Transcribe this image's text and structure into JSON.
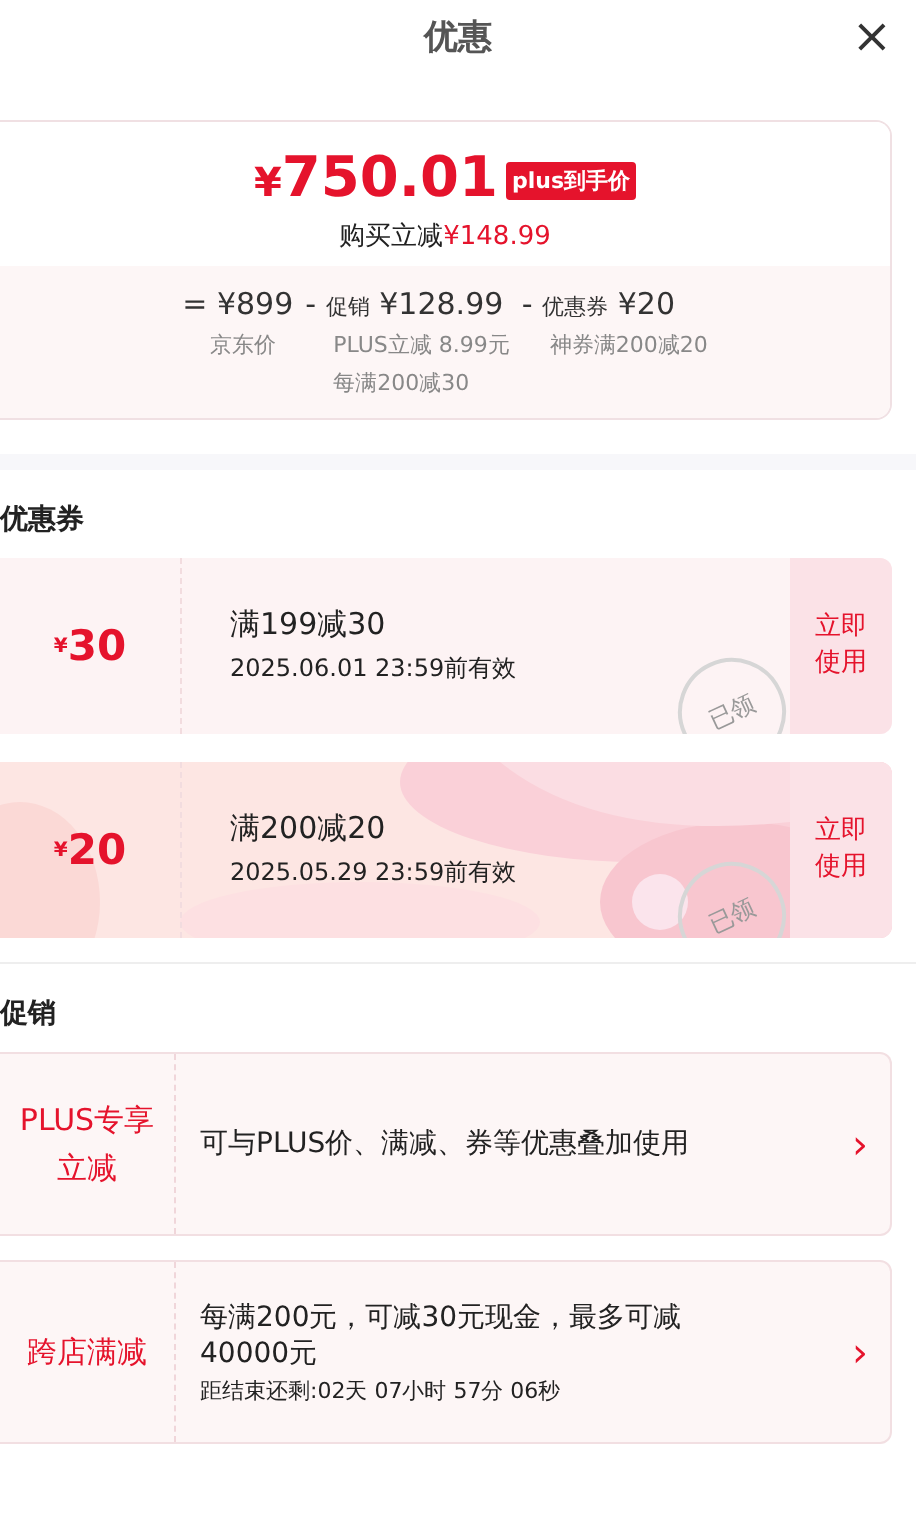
{
  "header": {
    "title": "优惠",
    "close": "×"
  },
  "summary": {
    "currency": "¥",
    "price": "750.01",
    "badge": "plus到手价",
    "saving_label": "购买立减",
    "saving": "¥148.99",
    "breakdown": [
      {
        "op": "=",
        "amount": "¥899",
        "notes": [
          "京东价"
        ]
      },
      {
        "op": "-",
        "label": "促销",
        "amount": "¥128.99",
        "notes": [
          "PLUS立减 8.99元",
          "每满200减30"
        ]
      },
      {
        "op": "-",
        "label": "优惠券",
        "amount": "¥20",
        "notes": [
          "神券满200减20"
        ]
      }
    ]
  },
  "coupons_section": {
    "title": "优惠券",
    "coupons": [
      {
        "kind": "plain",
        "currency": "¥",
        "value": "30",
        "condition": "满199减30",
        "validity": "2025.06.01 23:59前有效",
        "stamp": "已领",
        "action": "立即使用"
      },
      {
        "kind": "picture",
        "currency": "¥",
        "value": "20",
        "condition": "满200减20",
        "validity": "2025.05.29 23:59前有效",
        "stamp": "已领",
        "action": "立即使用"
      }
    ]
  },
  "promotions_section": {
    "title": "促销",
    "promotions": [
      {
        "tag": "PLUS专享立减",
        "lines": [
          "可与PLUS价、满减、券等优惠叠加使用"
        ],
        "arrow": "›"
      },
      {
        "tag": "跨店满减",
        "lines": [
          "每满200元，可减30元现金，最多可减40000元"
        ],
        "countdown": "距结束还剩:02天 07小时 57分 06秒",
        "arrow": "›"
      }
    ]
  }
}
